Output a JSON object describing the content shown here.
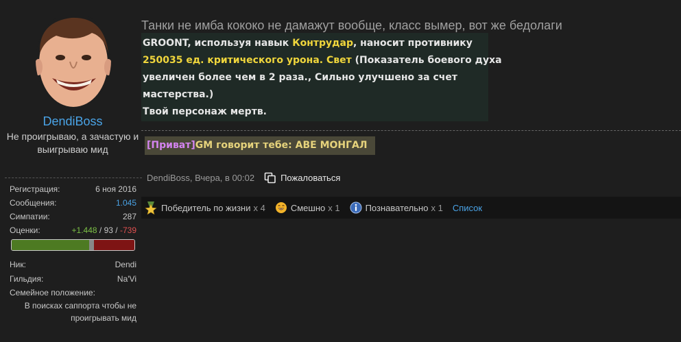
{
  "user": {
    "username": "DendiBoss",
    "title": "Не проигрываю, а зачастую и выигрываю мид",
    "stats": [
      {
        "label": "Регистрация:",
        "value": "6 ноя 2016"
      },
      {
        "label": "Сообщения:",
        "value": "1.045"
      },
      {
        "label": "Симпатии:",
        "value": "287"
      }
    ],
    "ratings": {
      "label": "Оценки:",
      "positive": "+1.448",
      "sep1": " / ",
      "neutral": "93",
      "sep2": " / ",
      "negative": "-739"
    },
    "rating_bar": {
      "positive_fraction": 0.63,
      "neutral_fraction": 0.04,
      "negative_fraction": 0.33
    },
    "fields": [
      {
        "label": "Ник:",
        "value": "Dendi"
      },
      {
        "label": "Гильдия:",
        "value": "Na'Vi"
      }
    ],
    "family": {
      "label": "Семейное положение:",
      "value": "В поисках саппорта чтобы не проигрывать мид"
    }
  },
  "post": {
    "text": "Танки не имба кококо не дамажут вообще, класс вымер, вот же бедолаги",
    "game_log": {
      "l1a": "GROONT, используя навык ",
      "l1b": "Контрудар",
      "l1c": ", наносит противнику",
      "l2a": "250035 ед. критического урона.  Свет",
      "l2b": " (Показатель боевого духа",
      "l3": " увеличен более чем в 2 раза., Сильно улучшено за счет",
      "l4": "мастерства.)",
      "l5": "Твой персонаж мертв."
    },
    "private": {
      "tag": "[Приват]",
      "text": "GM говорит тебе: АВЕ МОНГАЛ"
    },
    "meta": {
      "author_date": "DendiBoss, Вчера, в 00:02",
      "report": "Пожаловаться"
    },
    "likes": [
      {
        "label": "Победитель по жизни",
        "count": "x 4"
      },
      {
        "label": "Смешно",
        "count": "x 1"
      },
      {
        "label": "Познавательно",
        "count": "x 1"
      }
    ],
    "list_label": "Список"
  },
  "colors": {
    "link": "#4aa3e6",
    "positive": "#7cc146",
    "negative": "#e05050",
    "highlight": "#f0d63c",
    "private_tag": "#d484f0"
  }
}
